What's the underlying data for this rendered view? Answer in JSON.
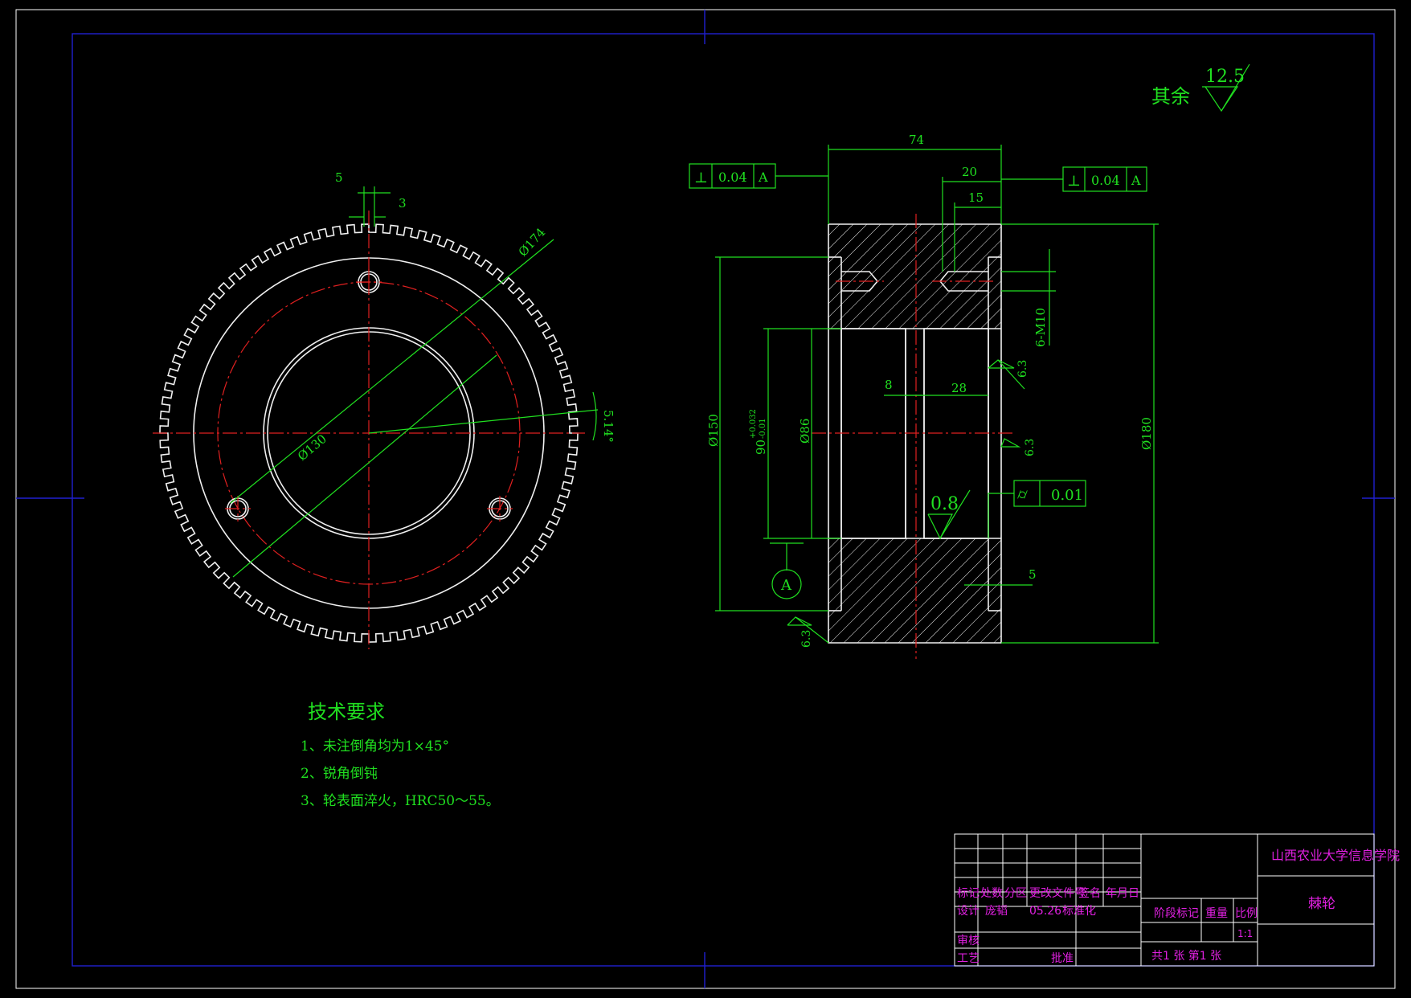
{
  "surface_finish": {
    "label": "其余",
    "value": "12.5"
  },
  "front_view": {
    "dims": {
      "tooth_width": "5",
      "tooth_gap": "3",
      "d174": "Ø174",
      "d130": "Ø130",
      "angle": "5.14°"
    }
  },
  "section_view": {
    "dims": {
      "width": "74",
      "w20": "20",
      "w15": "15",
      "thread": "6-M10",
      "d8": "8",
      "d28": "28",
      "d5": "5",
      "d150": "Ø150",
      "d86": "Ø86",
      "d90": "90",
      "tol_plus": "+0.032",
      "tol_minus": "-0.01",
      "d180": "Ø180"
    },
    "roughness": {
      "r63": "6.3",
      "r08": "0.8"
    },
    "tolerance_left": {
      "symbol": "⊥",
      "value": "0.04",
      "datum": "A"
    },
    "tolerance_right": {
      "symbol": "⊥",
      "value": "0.04",
      "datum": "A"
    },
    "tolerance_cyl": {
      "symbol": "⌭",
      "value": "0.01"
    },
    "datum_label": "A"
  },
  "tech_requirements": {
    "title": "技术要求",
    "items": [
      "1、未注倒角均为1×45°",
      "2、锐角倒钝",
      "3、轮表面淬火，HRC50～55。"
    ]
  },
  "title_block": {
    "school": "山西农业大学信息学院",
    "part_name": "棘轮",
    "row_marks": [
      "标记",
      "处数",
      "分区",
      "更改文件号",
      "签名",
      "年月日"
    ],
    "design_row": [
      "设计",
      "庞韬",
      "05.26",
      "标准化"
    ],
    "stage_headers": [
      "阶段标记",
      "重量",
      "比例"
    ],
    "scale": "1:1",
    "review": "审核",
    "process": "工艺",
    "approve": "批准",
    "sheets": "共1 张 第1 张"
  },
  "colors": {
    "green": "#20e020",
    "magenta": "#e020e0",
    "red": "#e02020",
    "white": "#f0f0f0",
    "border": "#2020d0"
  }
}
